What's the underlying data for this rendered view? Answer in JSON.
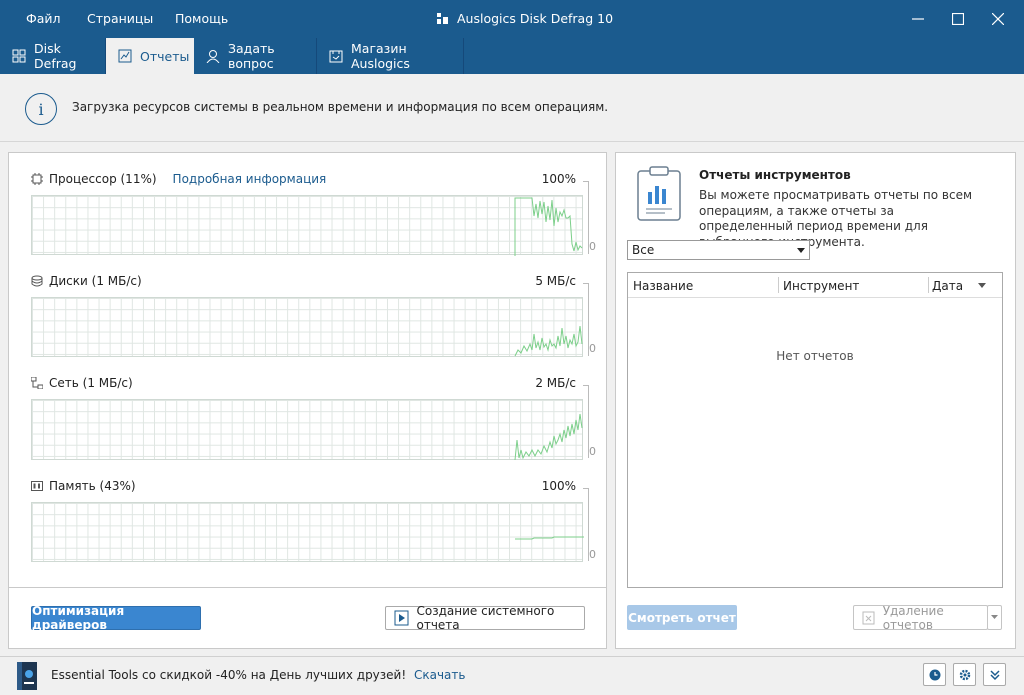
{
  "menu": {
    "file": "Файл",
    "pages": "Страницы",
    "help": "Помощь"
  },
  "app_title": "Auslogics Disk Defrag 10",
  "tabs": [
    {
      "label": "Disk Defrag",
      "icon": "grid-icon"
    },
    {
      "label": "Отчеты",
      "icon": "report-icon"
    },
    {
      "label": "Задать вопрос",
      "icon": "person-icon"
    },
    {
      "label": "Магазин Auslogics",
      "icon": "store-icon"
    }
  ],
  "info": {
    "text": "Загрузка ресурсов системы в реальном времени и информация по всем операциям."
  },
  "metrics": {
    "cpu": {
      "label": "Процессор (11%)",
      "max": "100%",
      "min": "0",
      "link": "Подробная информация",
      "value_percent": 11
    },
    "disk": {
      "label": "Диски (1 МБ/с)",
      "max": "5 МБ/с",
      "min": "0"
    },
    "net": {
      "label": "Сеть (1 МБ/с)",
      "max": "2 МБ/с",
      "min": "0"
    },
    "mem": {
      "label": "Память (43%)",
      "max": "100%",
      "min": "0",
      "value_percent": 43
    }
  },
  "buttons": {
    "optimize_drivers": "Оптимизация драйверов",
    "system_report": "Создание системного отчета",
    "view_report": "Смотреть отчет",
    "delete_reports": "Удаление отчетов"
  },
  "reports": {
    "title": "Отчеты инструментов",
    "description": "Вы можете просматривать отчеты по всем операциям, а также отчеты за определенный период времени для выбранного инструмента.",
    "filter_value": "Все",
    "columns": [
      "Название",
      "Инструмент",
      "Дата"
    ],
    "empty": "Нет отчетов"
  },
  "promo": {
    "text": "Essential Tools со скидкой -40% на День лучших друзей!",
    "link": "Скачать"
  },
  "colors": {
    "titlebar": "#1b5b8e",
    "accent_button": "#3a86d0",
    "graph_line": "#7ccf8a",
    "grid": "#dfe6e2"
  }
}
